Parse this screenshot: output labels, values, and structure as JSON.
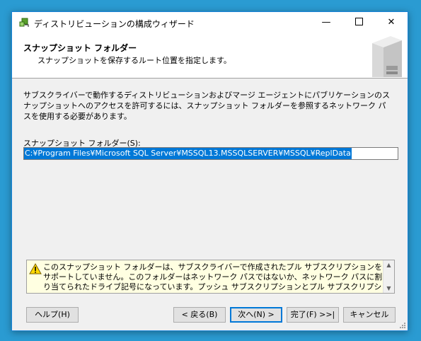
{
  "window": {
    "title": "ディストリビューションの構成ウィザード",
    "min_glyph": "—",
    "close_glyph": "✕"
  },
  "header": {
    "title": "スナップショット フォルダー",
    "subtitle": "スナップショットを保存するルート位置を指定します。"
  },
  "description": "サブスクライバーで動作するディストリビューションおよびマージ エージェントにパブリケーションのスナップショットへのアクセスを許可するには、スナップショット フォルダーを参照するネットワーク パスを使用する必要があります。",
  "snapshot_folder": {
    "label": "スナップショット フォルダー(S):",
    "value": "C:¥Program Files¥Microsoft SQL Server¥MSSQL13.MSSQLSERVER¥MSSQL¥ReplData"
  },
  "warning": {
    "icon": "warning-icon",
    "text": "このスナップショット フォルダーは、サブスクライバーで作成されたプル サブスクリプションをサポートしていません。このフォルダーはネットワーク パスではないか、ネットワーク パスに割り当てられたドライブ記号になっています。プッシュ サブスクリプションとプル サブスクリプションの両方をサポートするには、このフォルダーのネッ",
    "scroll_up": "▲",
    "scroll_down": "▼"
  },
  "buttons": {
    "help": "ヘルプ(H)",
    "back": "< 戻る(B)",
    "next": "次へ(N) >",
    "finish": "完了(F) >>|",
    "cancel": "キャンセル"
  },
  "colors": {
    "desktop": "#2a9bd2",
    "accent": "#0078d7",
    "warning_bg": "#ffffe1"
  }
}
